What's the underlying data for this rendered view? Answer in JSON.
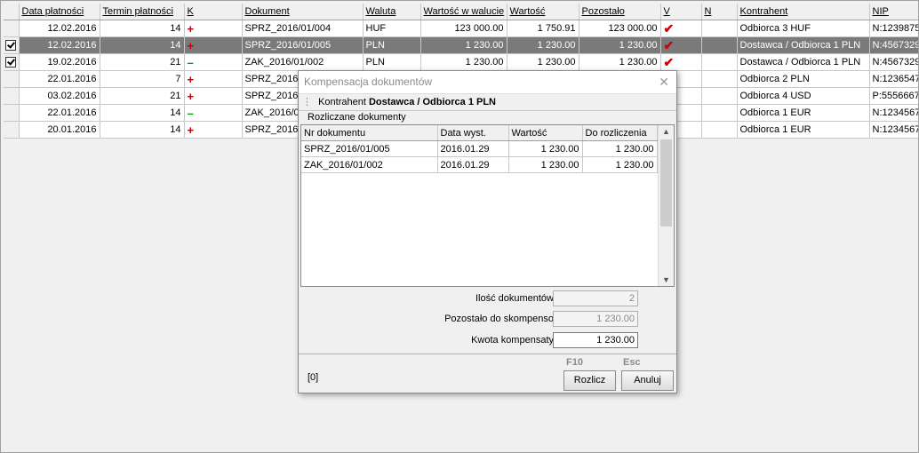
{
  "grid": {
    "headers": [
      "Data płatności",
      "Termin płatności",
      "K",
      "Dokument",
      "Waluta",
      "Wartość w walucie",
      "Wartość",
      "Pozostało",
      "V",
      "N",
      "Kontrahent",
      "NIP"
    ],
    "rows": [
      {
        "checkbox": "none",
        "data": "12.02.2016",
        "termin": "14",
        "k": "+",
        "dok": "SPRZ_2016/01/004",
        "waluta": "HUF",
        "wwal": "123 000.00",
        "wart": "1 750.91",
        "poz": "123 000.00",
        "v": "✔",
        "n": "",
        "kontr": "Odbiorca 3 HUF",
        "nip": "N:1239875"
      },
      {
        "checkbox": "on",
        "data": "12.02.2016",
        "termin": "14",
        "k": "+",
        "dok": "SPRZ_2016/01/005",
        "waluta": "PLN",
        "wwal": "1 230.00",
        "wart": "1 230.00",
        "poz": "1 230.00",
        "v": "✔",
        "n": "",
        "kontr": "Dostawca / Odbiorca 1 PLN",
        "nip": "N:4567329"
      },
      {
        "checkbox": "on",
        "data": "19.02.2016",
        "termin": "21",
        "k": "–",
        "dok": "ZAK_2016/01/002",
        "waluta": "PLN",
        "wwal": "1 230.00",
        "wart": "1 230.00",
        "poz": "1 230.00",
        "v": "✔",
        "n": "",
        "kontr": "Dostawca / Odbiorca 1 PLN",
        "nip": "N:4567329"
      },
      {
        "checkbox": "off",
        "data": "22.01.2016",
        "termin": "7",
        "k": "+",
        "dok": "SPRZ_2016/",
        "waluta": "",
        "wwal": "",
        "wart": "",
        "poz": "",
        "v": "",
        "n": "",
        "kontr": "Odbiorca 2 PLN",
        "nip": "N:1236547"
      },
      {
        "checkbox": "off",
        "data": "03.02.2016",
        "termin": "21",
        "k": "+",
        "dok": "SPRZ_2016/",
        "waluta": "",
        "wwal": "",
        "wart": "",
        "poz": "",
        "v": "",
        "n": "",
        "kontr": "Odbiorca 4 USD",
        "nip": "P:5556667"
      },
      {
        "checkbox": "off",
        "data": "22.01.2016",
        "termin": "14",
        "k": "–",
        "dok": "ZAK_2016/0",
        "waluta": "",
        "wwal": "",
        "wart": "",
        "poz": "",
        "v": "",
        "n": "",
        "kontr": "Odbiorca 1 EUR",
        "nip": "N:1234567"
      },
      {
        "checkbox": "off",
        "data": "20.01.2016",
        "termin": "14",
        "k": "+",
        "dok": "SPRZ_2016/",
        "waluta": "",
        "wwal": "",
        "wart": "",
        "poz": "",
        "v": "",
        "n": "",
        "kontr": "Odbiorca 1 EUR",
        "nip": "N:1234567"
      }
    ]
  },
  "dialog": {
    "title": "Kompensacja dokumentów",
    "kontrahent_label": "Kontrahent",
    "kontrahent_value": "Dostawca / Odbiorca 1 PLN",
    "section_label": "Rozliczane dokumenty",
    "table": {
      "headers": [
        "Nr dokumentu",
        "Data wyst.",
        "Wartość",
        "Do rozliczenia"
      ],
      "rows": [
        [
          "SPRZ_2016/01/005",
          "2016.01.29",
          "1 230.00",
          "1 230.00"
        ],
        [
          "ZAK_2016/01/002",
          "2016.01.29",
          "1 230.00",
          "1 230.00"
        ]
      ]
    },
    "fields": {
      "ilosc_label": "Ilość dokumentów",
      "ilosc_value": "2",
      "pozostalo_label": "Pozostało do skompenso",
      "pozostalo_value": "1 230.00",
      "kwota_label": "Kwota kompensaty",
      "kwota_value": "1 230.00"
    },
    "count": "[0]",
    "rozlicz_key": "F10",
    "rozlicz_label": "Rozlicz",
    "anuluj_key": "Esc",
    "anuluj_label": "Anuluj"
  },
  "colors": {
    "selected_row": "#7a7a7a",
    "plus": "#c00000",
    "minus": "#00a000",
    "check": "#d00000"
  }
}
